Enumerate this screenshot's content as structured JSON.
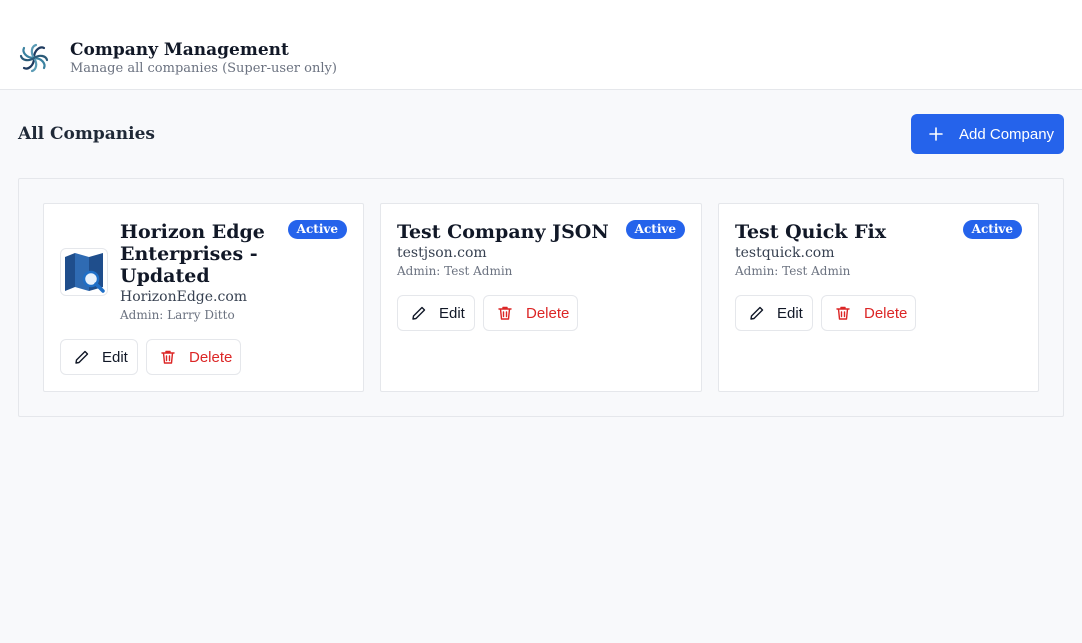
{
  "header": {
    "title": "Company Management",
    "subtitle": "Manage all companies (Super-user only)"
  },
  "section": {
    "title": "All Companies",
    "add_button_label": "Add Company"
  },
  "companies": [
    {
      "name": "Horizon Edge Enterprises - Updated",
      "name_lines": [
        "Horizon Edge",
        "Enterprises -",
        "Updated"
      ],
      "domain": "HorizonEdge.com",
      "admin": "Admin: Larry Ditto",
      "status": "Active",
      "has_logo": true
    },
    {
      "name": "Test Company JSON",
      "domain": "testjson.com",
      "admin": "Admin: Test Admin",
      "status": "Active",
      "has_logo": false
    },
    {
      "name": "Test Quick Fix",
      "domain": "testquick.com",
      "admin": "Admin: Test Admin",
      "status": "Active",
      "has_logo": false
    }
  ],
  "actions": {
    "edit_label": "Edit",
    "delete_label": "Delete"
  },
  "colors": {
    "primary": "#2563eb",
    "danger": "#dc2626",
    "background": "#f8f9fb"
  },
  "icons": {
    "app_logo": "pinwheel-logo-icon",
    "add": "plus-icon",
    "edit": "pencil-icon",
    "delete": "trash-icon",
    "company_logo": "map-search-icon"
  }
}
